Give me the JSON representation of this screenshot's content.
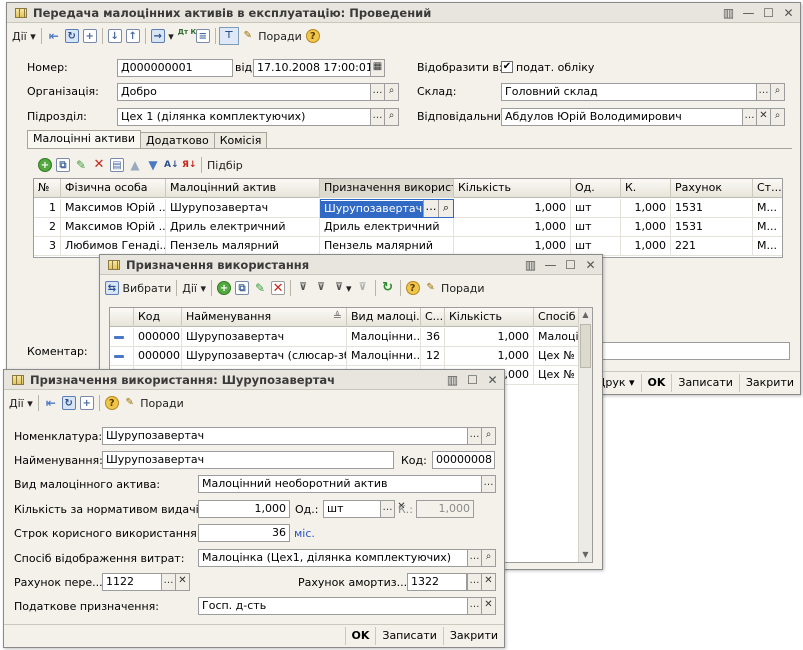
{
  "w1": {
    "title": "Передача малоцінних активів в експлуатацію: Проведений",
    "toolbar": {
      "actions": "Дії",
      "tips": "Поради",
      "dtkt": "Дт Кт"
    },
    "nomer_label": "Номер:",
    "nomer": "Д000000001",
    "vid_label": "від:",
    "vid": "17.10.2008 17:00:01",
    "vidobr_label": "Відобразити в:",
    "vidobr_check": "подат. обліку",
    "org_label": "Організація:",
    "org": "Добро",
    "sklad_label": "Склад:",
    "sklad": "Головний склад",
    "pidrozdil_label": "Підрозділ:",
    "pidrozdil": "Цех 1 (ділянка комплектуючих)",
    "vidpov_label": "Відповідальний:",
    "vidpov": "Абдулов Юрій Володимирович",
    "tabs": [
      "Малоцінні активи",
      "Додатково",
      "Комісія"
    ],
    "pidbir": "Підбір",
    "headers": [
      "№",
      "Фізична особа",
      "Малоцінний актив",
      "Призначення використ...",
      "Кількість",
      "Од.",
      "К.",
      "Рахунок",
      "Ст..."
    ],
    "rows": [
      [
        "1",
        "Максимов Юрій ...",
        "Шурупозавертач",
        "Шурупозавертач",
        "1,000",
        "шт",
        "1,000",
        "1531",
        "М..."
      ],
      [
        "2",
        "Максимов Юрій ...",
        "Дриль електричний",
        "Дриль електричний",
        "1,000",
        "шт",
        "1,000",
        "1531",
        "М..."
      ],
      [
        "3",
        "Любимов Генаді...",
        "Пензель малярний",
        "Пензель малярний",
        "1,000",
        "шт",
        "1,000",
        "221",
        "М..."
      ]
    ],
    "comment_label": "Коментар:",
    "bottom": {
      "print": "Друк",
      "ok": "OK",
      "save": "Записати",
      "close": "Закрити"
    }
  },
  "w2": {
    "title": "Призначення використання",
    "toolbar": {
      "select": "Вибрати",
      "actions": "Дії",
      "tips": "Поради"
    },
    "headers": [
      "Код",
      "Найменування",
      "Вид малоці...",
      "С...",
      "Кількість",
      "Спосіб"
    ],
    "rows": [
      [
        "000000...",
        "Шурупозавертач",
        "Малоцінни...",
        "36",
        "1,000",
        "Малоці"
      ],
      [
        "000000...",
        "Шурупозавертач (слюсар-зб...",
        "Малоцінни...",
        "12",
        "1,000",
        "Цех №"
      ],
      [
        "",
        "",
        "",
        "",
        "1,000",
        "Цех №"
      ]
    ]
  },
  "w3": {
    "title": "Призначення використання: Шурупозавертач",
    "toolbar": {
      "actions": "Дії",
      "tips": "Поради"
    },
    "nomenklatura_label": "Номенклатура:",
    "nomenklatura": "Шурупозавертач",
    "naimenuvannia_label": "Найменування:",
    "naimenuvannia": "Шурупозавертач",
    "kod_label": "Код:",
    "kod": "00000008",
    "vid_label": "Вид малоцінного актива:",
    "vid": "Малоцінний необоротний актив",
    "kilkist_label": "Кількість за нормативом видачі:",
    "kilkist": "1,000",
    "od_label": "Од.:",
    "od": "шт",
    "k_label": "К.:",
    "k": "1,000",
    "strok_label": "Строк корисного використання:",
    "strok": "36",
    "mis": "міс.",
    "sposib_label": "Спосіб відображення витрат:",
    "sposib": "Малоцінка (Цех1, ділянка комплектуючих)",
    "rakhunok_pere_label": "Рахунок пере...",
    "rakhunok_pere": "1122",
    "rakhunok_amort_label": "Рахунок амортиз...",
    "rakhunok_amort": "1322",
    "podatk_label": "Податкове призначення:",
    "podatk": "Госп. д-сть",
    "bottom": {
      "ok": "OK",
      "save": "Записати",
      "close": "Закрити"
    }
  }
}
